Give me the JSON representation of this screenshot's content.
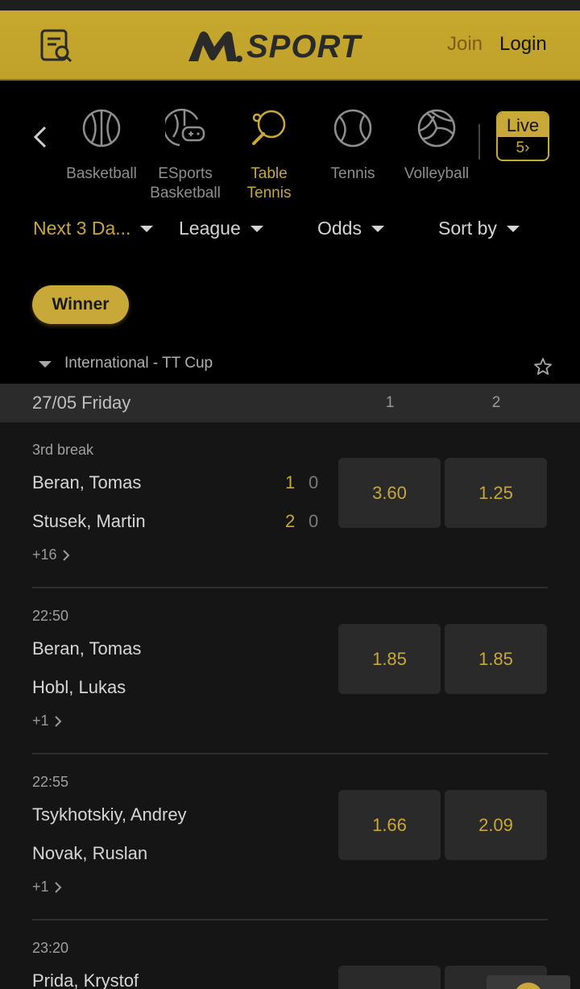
{
  "header": {
    "logo_text": "SPORT",
    "join_label": "Join",
    "login_label": "Login"
  },
  "sports": [
    {
      "label_line1": "Basketball",
      "label_line2": "",
      "icon": "basketball-icon",
      "active": false
    },
    {
      "label_line1": "ESports",
      "label_line2": "Basketball",
      "icon": "esports-basketball-icon",
      "active": false
    },
    {
      "label_line1": "Table",
      "label_line2": "Tennis",
      "icon": "table-tennis-icon",
      "active": true
    },
    {
      "label_line1": "Tennis",
      "label_line2": "",
      "icon": "tennis-icon",
      "active": false
    },
    {
      "label_line1": "Volleyball",
      "label_line2": "",
      "icon": "volleyball-icon",
      "active": false
    }
  ],
  "live": {
    "label": "Live",
    "count": "5›"
  },
  "filters": {
    "days": "Next 3 Da...",
    "league": "League",
    "odds": "Odds",
    "sort": "Sort by"
  },
  "market_pill": "Winner",
  "league": {
    "name": "International - TT Cup"
  },
  "date_header": {
    "date": "27/05 Friday",
    "col1": "1",
    "col2": "2"
  },
  "matches": [
    {
      "time": "3rd break",
      "team1": "Beran, Tomas",
      "team2": "Stusek, Martin",
      "score1_set": "1",
      "score1_game": "0",
      "score2_set": "2",
      "score2_game": "0",
      "odd1": "3.60",
      "odd2": "1.25",
      "markets": "+16"
    },
    {
      "time": "22:50",
      "team1": "Beran, Tomas",
      "team2": "Hobl, Lukas",
      "odd1": "1.85",
      "odd2": "1.85",
      "markets": "+1"
    },
    {
      "time": "22:55",
      "team1": "Tsykhotskiy, Andrey",
      "team2": "Novak, Ruslan",
      "odd1": "1.66",
      "odd2": "2.09",
      "markets": "+1"
    },
    {
      "time": "23:20",
      "team1": "Prida, Krystof"
    }
  ],
  "colors": {
    "accent": "#c8a838",
    "header_bg": "#c4a52c",
    "page_bg": "#151515",
    "nav_bg": "#000000"
  }
}
